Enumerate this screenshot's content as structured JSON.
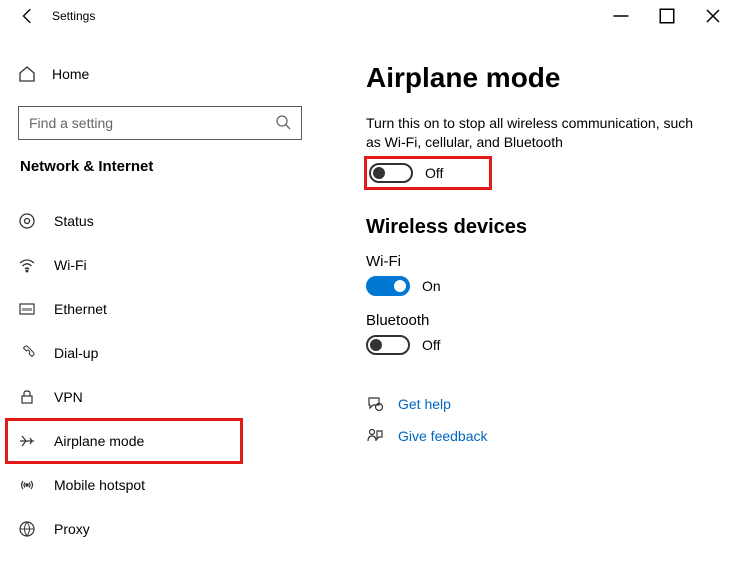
{
  "titlebar": {
    "title": "Settings"
  },
  "sidebar": {
    "home_label": "Home",
    "search_placeholder": "Find a setting",
    "section_label": "Network & Internet",
    "items": [
      {
        "label": "Status"
      },
      {
        "label": "Wi-Fi"
      },
      {
        "label": "Ethernet"
      },
      {
        "label": "Dial-up"
      },
      {
        "label": "VPN"
      },
      {
        "label": "Airplane mode"
      },
      {
        "label": "Mobile hotspot"
      },
      {
        "label": "Proxy"
      }
    ]
  },
  "main": {
    "heading": "Airplane mode",
    "description": "Turn this on to stop all wireless communication, such as Wi-Fi, cellular, and Bluetooth",
    "airplane_toggle": {
      "state": "Off"
    },
    "wireless_heading": "Wireless devices",
    "wifi_label": "Wi-Fi",
    "wifi_toggle": {
      "state": "On"
    },
    "bt_label": "Bluetooth",
    "bt_toggle": {
      "state": "Off"
    },
    "help_label": "Get help",
    "feedback_label": "Give feedback"
  }
}
